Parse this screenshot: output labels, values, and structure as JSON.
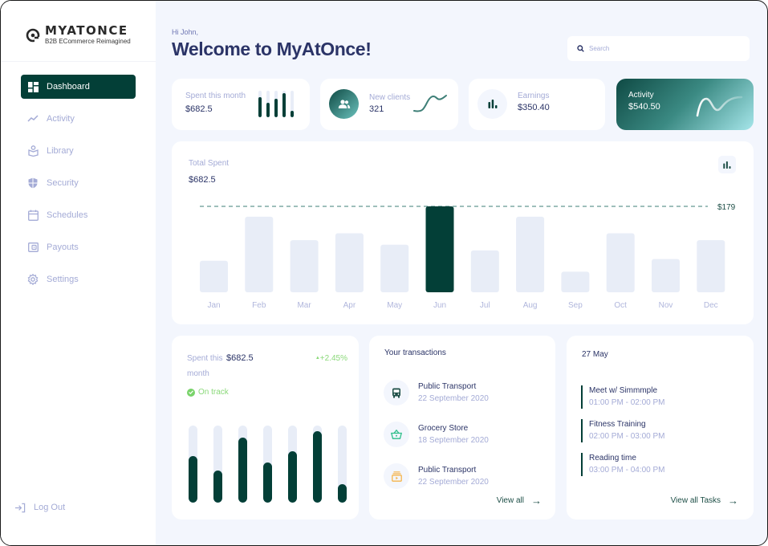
{
  "brand": {
    "name": "MYATONCE",
    "tagline": "B2B ECommerce Reimagined"
  },
  "sidebar": {
    "items": [
      {
        "label": "Dashboard",
        "icon": "dashboard-icon",
        "active": true
      },
      {
        "label": "Activity",
        "icon": "activity-icon",
        "active": false
      },
      {
        "label": "Library",
        "icon": "library-icon",
        "active": false
      },
      {
        "label": "Security",
        "icon": "shield-icon",
        "active": false
      },
      {
        "label": "Schedules",
        "icon": "calendar-icon",
        "active": false
      },
      {
        "label": "Payouts",
        "icon": "wallet-icon",
        "active": false
      },
      {
        "label": "Settings",
        "icon": "gear-icon",
        "active": false
      }
    ],
    "logout_label": "Log Out"
  },
  "header": {
    "greeting": "Hi John,",
    "title": "Welcome to MyAtOnce!",
    "search_placeholder": "Search"
  },
  "stats": {
    "spent": {
      "label": "Spent this month",
      "value": "$682.5",
      "bars": [
        0.75,
        0.55,
        0.7,
        0.9,
        0.25
      ]
    },
    "clients": {
      "label": "New clients",
      "value": "321"
    },
    "earnings": {
      "label": "Earnings",
      "value": "$350.40"
    },
    "activity": {
      "label": "Activity",
      "value": "$540.50"
    }
  },
  "colors": {
    "brand": "#033f37",
    "bar_idle": "#e8edf7",
    "positive": "#8bd97a",
    "text_primary": "#2b3467",
    "text_muted": "#a4abd6"
  },
  "chart_data": {
    "type": "bar",
    "title": "Total Spent",
    "total": "$682.5",
    "categories": [
      "Jan",
      "Feb",
      "Mar",
      "Apr",
      "May",
      "Jun",
      "Jul",
      "Aug",
      "Sep",
      "Oct",
      "Nov",
      "Dec"
    ],
    "values": [
      55,
      132,
      91,
      103,
      83,
      150,
      73,
      132,
      36,
      103,
      58,
      91
    ],
    "highlight_index": 5,
    "reference_line": {
      "label": "$179",
      "value": 150
    },
    "ylim": [
      0,
      150
    ],
    "xlabel": "",
    "ylabel": "",
    "grid": false
  },
  "monthly": {
    "label": "Spent this month",
    "value": "$682.5",
    "change": "+2.45%",
    "status": "On track",
    "bars": [
      0.6,
      0.42,
      0.84,
      0.52,
      0.67,
      0.93,
      0.24
    ]
  },
  "transactions": {
    "title": "Your transactions",
    "items": [
      {
        "name": "Public Transport",
        "date": "22 September 2020",
        "icon": "bus-icon",
        "color": "#1e4f47"
      },
      {
        "name": "Grocery Store",
        "date": "18 September 2020",
        "icon": "basket-icon",
        "color": "#2fbf8a"
      },
      {
        "name": "Public Transport",
        "date": "22 September 2020",
        "icon": "ticket-icon",
        "color": "#f5b44a"
      }
    ],
    "view_all": "View all"
  },
  "tasks": {
    "date": "27 May",
    "items": [
      {
        "name": "Meet w/ Simmmple",
        "time": "01:00 PM - 02:00 PM"
      },
      {
        "name": "Fitness Training",
        "time": "02:00 PM - 03:00 PM"
      },
      {
        "name": "Reading time",
        "time": "03:00 PM - 04:00 PM"
      }
    ],
    "view_all": "View all Tasks"
  }
}
